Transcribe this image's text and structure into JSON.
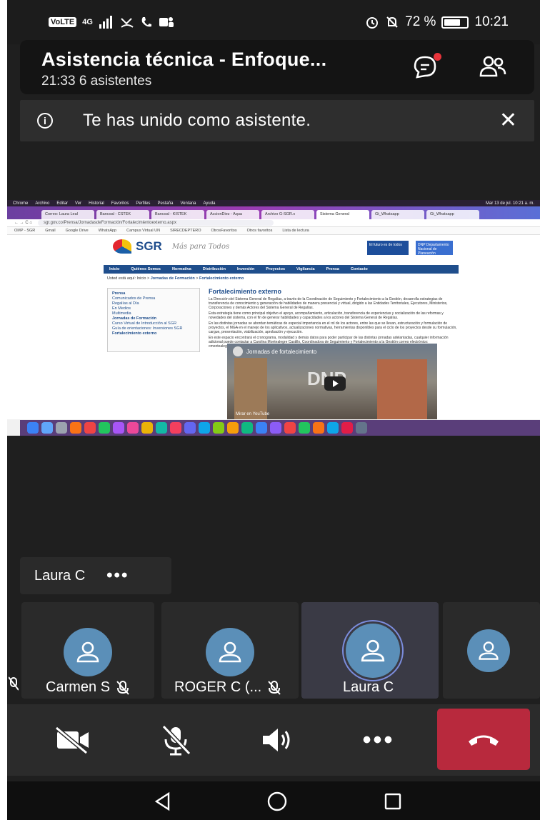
{
  "status_bar": {
    "volte": "VoLTE",
    "network": "4G",
    "battery_level": "72 %",
    "battery_fraction": 0.72,
    "time": "10:21"
  },
  "meeting": {
    "title": "Asistencia técnica - Enfoque...",
    "duration": "21:33",
    "attendees": "6 asistentes",
    "chat_icon": "chat-icon",
    "people_icon": "people-icon",
    "notification_color": "#e8343b"
  },
  "banner": {
    "message": "Te has unido como asistente.",
    "info_icon": "info-icon",
    "close_icon": "close-icon"
  },
  "shared_screen": {
    "mac_menu": [
      "Chrome",
      "Archivo",
      "Editar",
      "Ver",
      "Historial",
      "Favoritos",
      "Perfiles",
      "Pestaña",
      "Ventana",
      "Ayuda"
    ],
    "mac_clock": "Mar 13 de jul. 10:21 a. m.",
    "tabs": [
      "Correo: Laura Leal",
      "Bancoal - CSTEK",
      "Bancoal - KISTEK",
      "AccionDiez - Aqua",
      "Archivo G-SGR.x",
      "Sistema General",
      "Gt_Whatsapp",
      "Gt_Whatsapp"
    ],
    "url": "sgr.gov.co/Prensa/JornadasdeFormación/Fortalecimientoexterno.aspx",
    "bookmarks": [
      "OMP - SGR",
      "Gmail",
      "Google Drive",
      "WhatsApp",
      "Campus Virtual UN",
      "SIRECDEPTERO",
      "OtrosFavoritos",
      "Otros favoritos",
      "Lista de lectura"
    ],
    "site_logo": "SGR",
    "site_tagline": "Más para Todos",
    "gov_badge_1": "El futuro es de todos",
    "gov_badge_2": "DNP Departamento Nacional de Planeación",
    "nav": [
      "Inicio",
      "Quiénes Somos",
      "Normativa",
      "Distribución",
      "Inversión",
      "Proyectos",
      "Vigilancia",
      "Prensa",
      "Contacto"
    ],
    "breadcrumb_prefix": "Usted está aquí: Inicio >",
    "breadcrumb_section": "Jornadas de Formación",
    "breadcrumb_current": "Fortalecimiento externo",
    "sidebar": [
      "Prensa",
      "Comunicados de Prensa",
      "Regalías al Día",
      "En Medios",
      "Multimedia",
      "Jornadas de Formación",
      "Curso Virtual de Introducción al SGR",
      "Guía de orientaciones: Inversiones SGR",
      "Fortalecimiento externo"
    ],
    "content_heading": "Fortalecimiento externo",
    "content_paragraphs": [
      "La Dirección del Sistema General de Regalías, a través de la Coordinación de Seguimiento y Fortalecimiento a la Gestión, desarrolla estrategias de transferencia de conocimiento y generación de habilidades de manera presencial y virtual, dirigido a las Entidades Territoriales, Ejecutores, Ministerios, Corporaciones y demás Actores del Sistema General de Regalías.",
      "Esta estrategia tiene como principal objetivo el apoyo, acompañamiento, articulación, transferencia de experiencias y socialización de las reformas y novedades del sistema, con el fin de generar habilidades y capacidades a los actores del Sistema General de Regalías.",
      "En las distintas jornadas se abordan temáticas de especial importancia en el rol de los actores, entre las que se llevan, estructuración y formulación de proyectos, el MGA en el manejo de los aplicativos, actualizaciones normativas, herramientas disponibles para el ciclo de los proyectos desde su formulación, cargue, presentación, viabilización, aprobación y ejecución.",
      "En este espacio encontrará el cronograma, modalidad y demás datos para poder participar de las distintas jornadas adelantadas, cualquier información adicional puede contactar a Carolina Montealegre Castillo, Coordinadora de Seguimiento y Fortalecimiento a la Gestión correo electrónico: cmontealegre@dnp.gov.co Consultora Edna Toledo, correo electrónico: etoledo@sgr.gov.co"
    ],
    "video_title": "Jornadas de fortalecimiento",
    "video_brand": "DNP",
    "video_watch_on": "Mirar en YouTube"
  },
  "participant_label": {
    "name": "Laura C",
    "more": "•••"
  },
  "participants": [
    {
      "name": "Carmen S",
      "muted": true
    },
    {
      "name": "ROGER C (...",
      "muted": true
    },
    {
      "name": "Laura C",
      "muted": false,
      "active": true
    },
    {
      "name": "",
      "muted": false
    }
  ],
  "controls": {
    "camera": "camera-off-icon",
    "mic": "mic-off-icon",
    "speaker": "speaker-icon",
    "more": "•••",
    "hangup": "hangup-icon",
    "hangup_color": "#b8293d"
  },
  "android_nav": {
    "back": "back-icon",
    "home": "home-icon",
    "recents": "recents-icon"
  }
}
